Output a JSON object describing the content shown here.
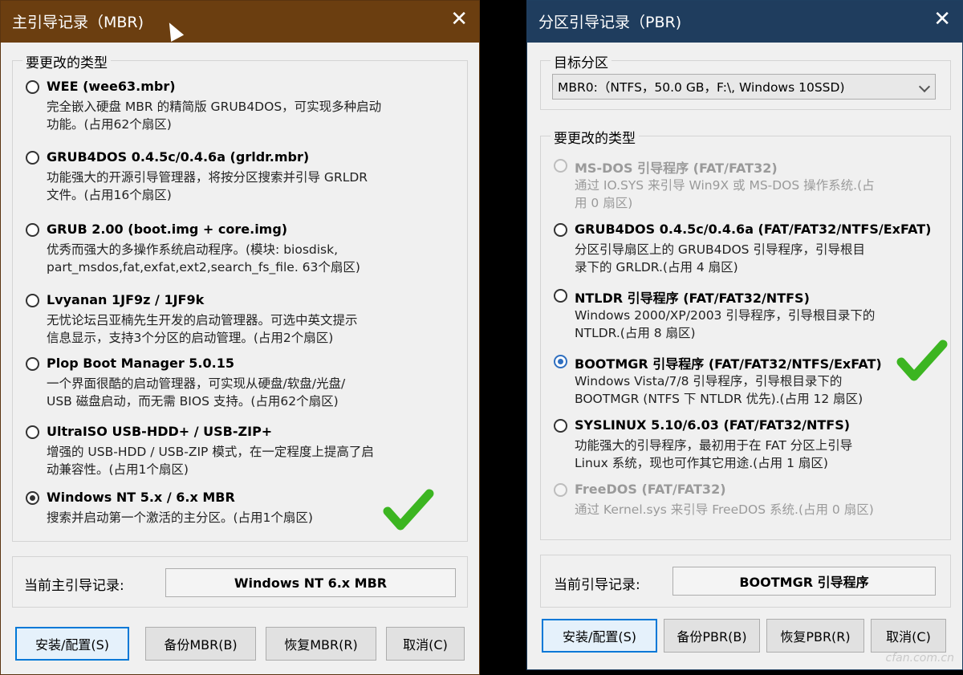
{
  "mbr": {
    "title": "主引导记录（MBR)",
    "close": "✕",
    "group_label": "要更改的类型",
    "options": [
      {
        "title": "WEE (wee63.mbr)",
        "desc": "完全嵌入硬盘 MBR 的精简版 GRUB4DOS，可实现多种启动\n功能。(占用62个扇区)",
        "selected": false
      },
      {
        "title": "GRUB4DOS 0.4.5c/0.4.6a (grldr.mbr)",
        "desc": "功能强大的开源引导管理器，将按分区搜索并引导 GRLDR\n文件。(占用16个扇区)",
        "selected": false
      },
      {
        "title": "GRUB 2.00 (boot.img + core.img)",
        "desc": "优秀而强大的多操作系统启动程序。(模块: biosdisk,\npart_msdos,fat,exfat,ext2,search_fs_file. 63个扇区)",
        "selected": false
      },
      {
        "title": "Lvyanan 1JF9z / 1JF9k",
        "desc": "无忧论坛吕亚楠先生开发的启动管理器。可选中英文提示\n信息显示，支持3个分区的启动管理。(占用2个扇区)",
        "selected": false
      },
      {
        "title": "Plop Boot Manager 5.0.15",
        "desc": "一个界面很酷的启动管理器，可实现从硬盘/软盘/光盘/\nUSB 磁盘启动，而无需 BIOS 支持。(占用62个扇区)",
        "selected": false
      },
      {
        "title": "UltraISO USB-HDD+ / USB-ZIP+",
        "desc": "增强的 USB-HDD / USB-ZIP 模式，在一定程度上提高了启\n动兼容性。(占用1个扇区)",
        "selected": false
      },
      {
        "title": "Windows NT 5.x / 6.x MBR",
        "desc": "搜索并启动第一个激活的主分区。(占用1个扇区)",
        "selected": true
      }
    ],
    "current_label": "当前主引导记录:",
    "current_value": "Windows NT 6.x MBR",
    "buttons": {
      "install": "安装/配置(S)",
      "backup": "备份MBR(B)",
      "restore": "恢复MBR(R)",
      "cancel": "取消(C)"
    }
  },
  "pbr": {
    "title": "分区引导记录（PBR)",
    "close": "✕",
    "target_label": "目标分区",
    "target_value": "MBR0:（NTFS，50.0 GB，F:\\, Windows 10SSD)",
    "group_label": "要更改的类型",
    "options": [
      {
        "title": "MS-DOS 引导程序 (FAT/FAT32)",
        "desc": "通过 IO.SYS 来引导 Win9X 或 MS-DOS 操作系统.(占\n用 0 扇区)",
        "selected": false,
        "disabled": true
      },
      {
        "title": "GRUB4DOS 0.4.5c/0.4.6a (FAT/FAT32/NTFS/ExFAT)",
        "desc": "分区引导扇区上的 GRUB4DOS 引导程序，引导根目\n录下的 GRLDR.(占用 4 扇区)",
        "selected": false,
        "disabled": false
      },
      {
        "title": "NTLDR 引导程序 (FAT/FAT32/NTFS)",
        "desc": "Windows 2000/XP/2003 引导程序，引导根目录下的\nNTLDR.(占用 8 扇区)",
        "selected": false,
        "disabled": false
      },
      {
        "title": "BOOTMGR 引导程序 (FAT/FAT32/NTFS/ExFAT)",
        "desc": "Windows Vista/7/8 引导程序，引导根目录下的\nBOOTMGR (NTFS 下 NTLDR 优先).(占用 12 扇区)",
        "selected": true,
        "disabled": false
      },
      {
        "title": "SYSLINUX 5.10/6.03 (FAT/FAT32/NTFS)",
        "desc": "功能强大的引导程序，最初用于在 FAT 分区上引导\nLinux 系统，现也可作其它用途.(占用 1 扇区)",
        "selected": false,
        "disabled": false
      },
      {
        "title": "FreeDOS (FAT/FAT32)",
        "desc": "通过 Kernel.sys 来引导 FreeDOS 系统.(占用 0 扇区)",
        "selected": false,
        "disabled": true
      }
    ],
    "current_label": "当前引导记录:",
    "current_value": "BOOTMGR 引导程序",
    "buttons": {
      "install": "安装/配置(S)",
      "backup": "备份PBR(B)",
      "restore": "恢复PBR(R)",
      "cancel": "取消(C)"
    }
  },
  "icons": {
    "check": "checkmark-icon",
    "cursor": "mouse-pointer-icon"
  },
  "colors": {
    "mbr_title": "#6b3e10",
    "pbr_title": "#1f3d5e",
    "check_green": "#3cb521",
    "accent": "#0078d7"
  },
  "watermark": "cfan.com.cn"
}
